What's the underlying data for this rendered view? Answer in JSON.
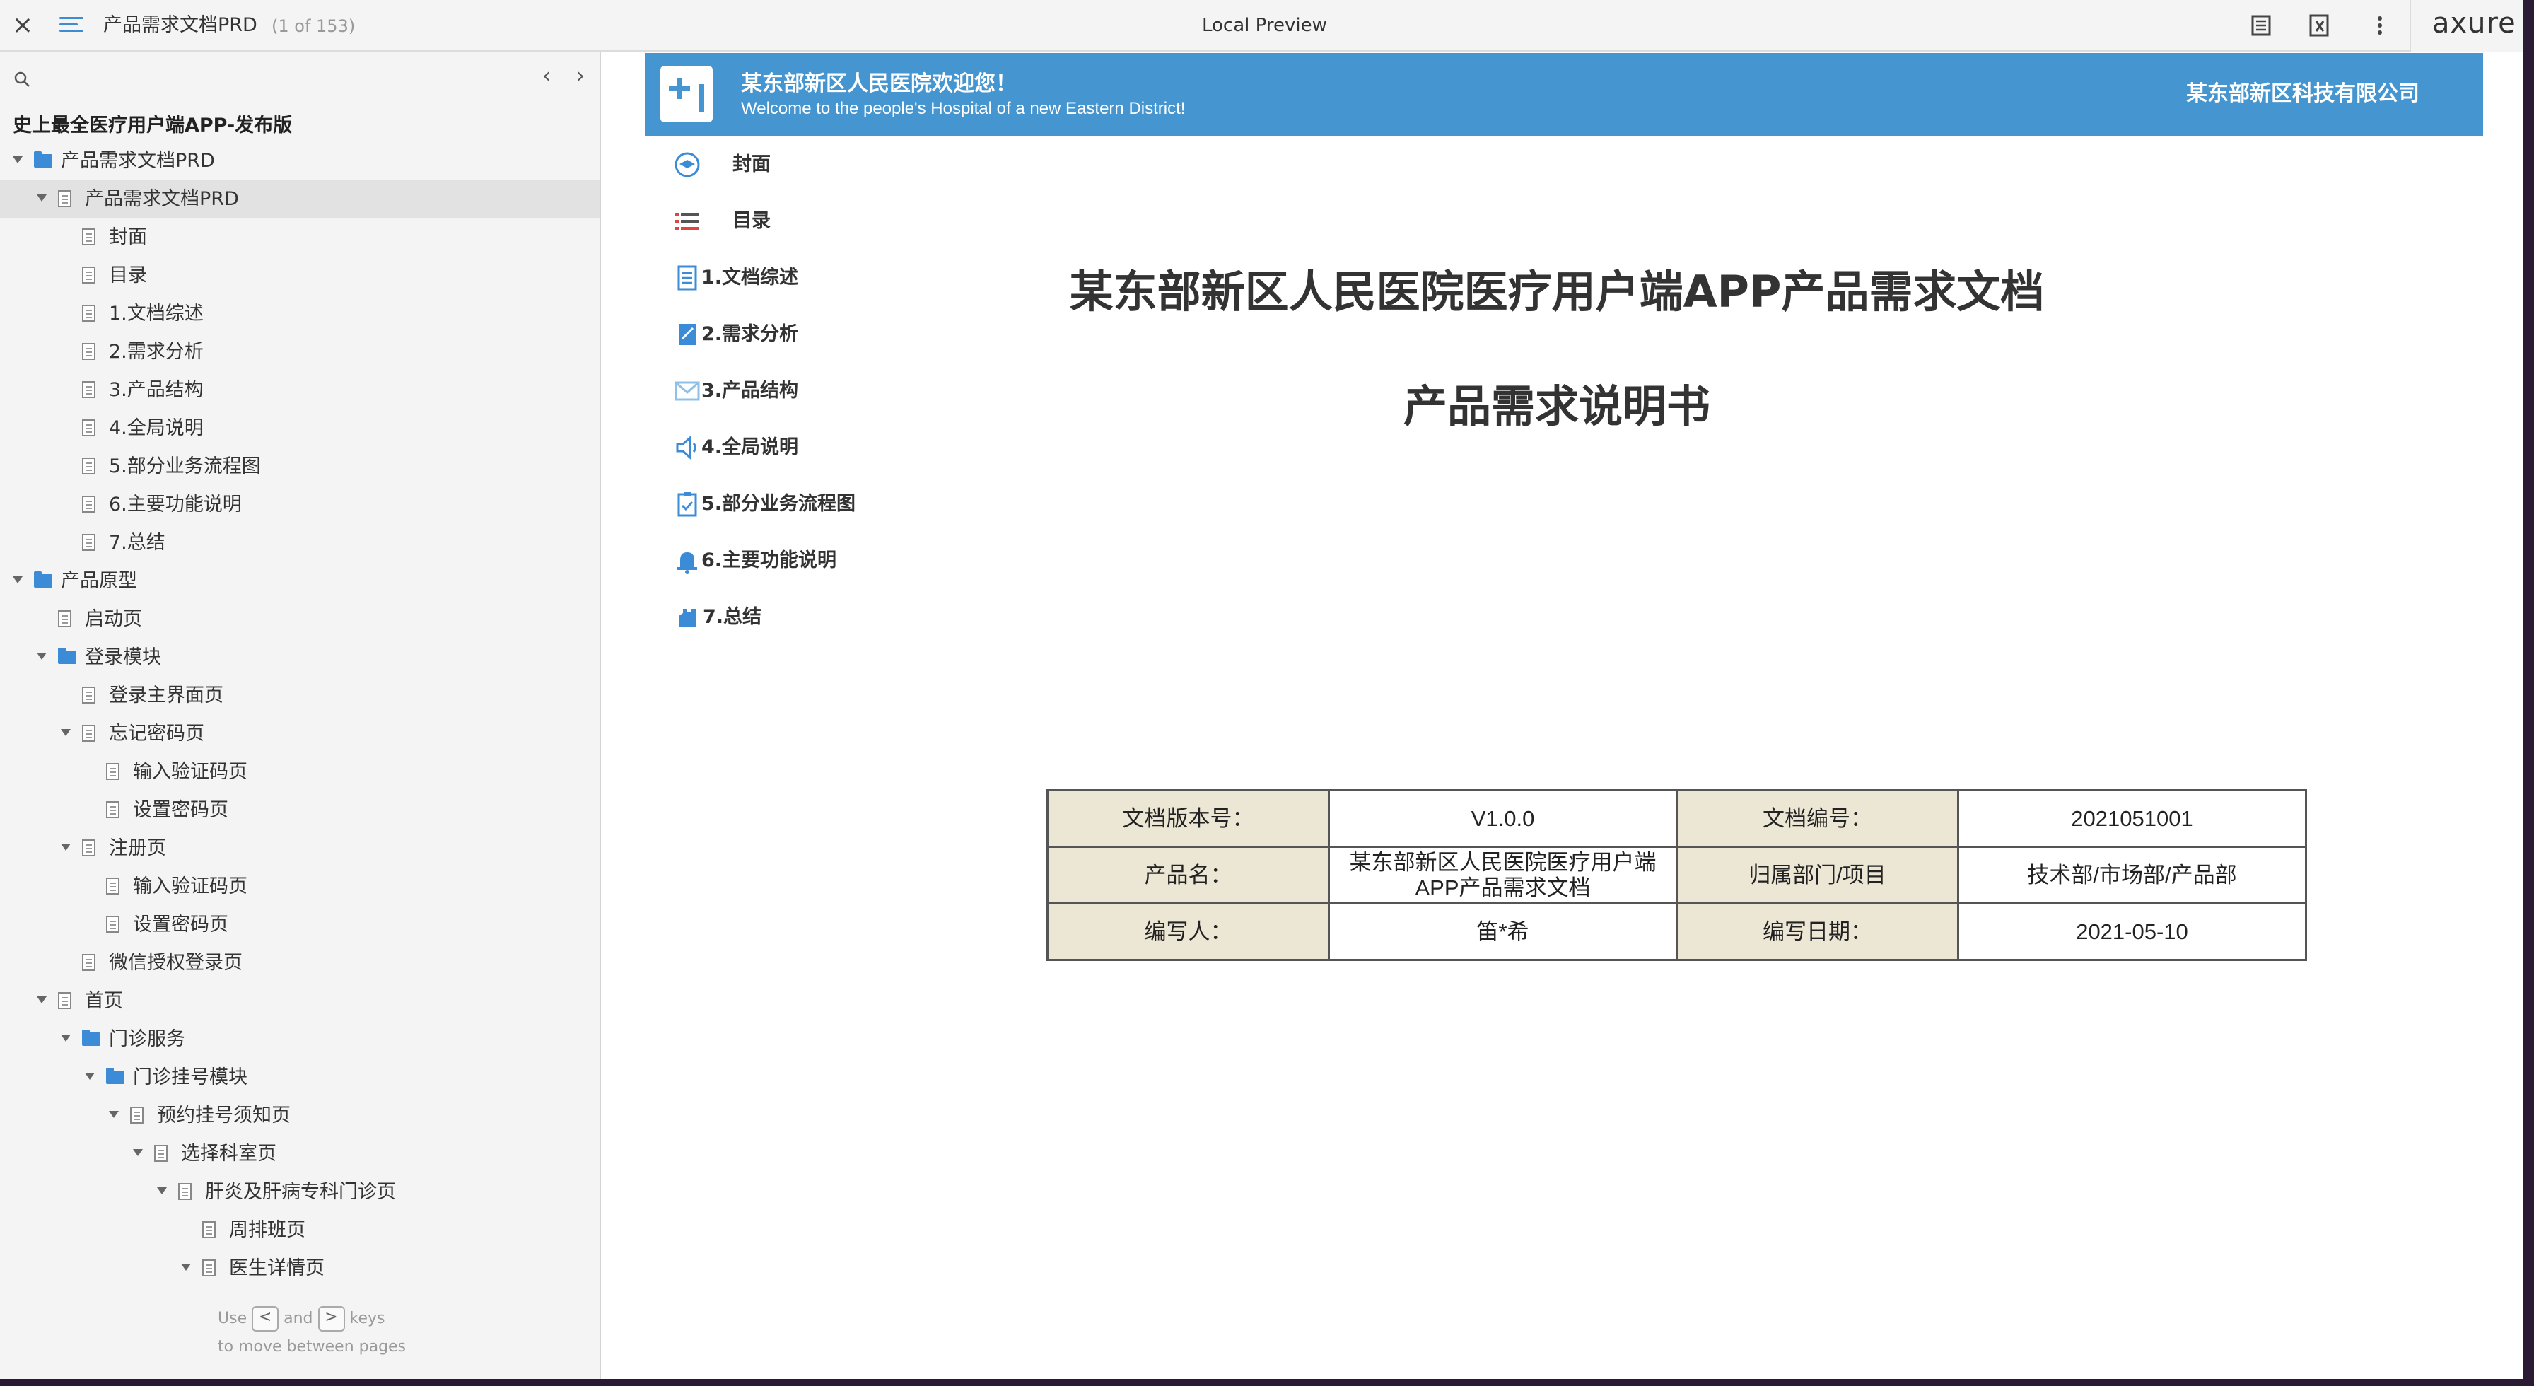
{
  "toolbar": {
    "close_glyph": "×",
    "doc_title": "产品需求文档PRD",
    "page_count": "(1 of 153)",
    "preview_label": "Local Preview",
    "logo": "axure",
    "icons": [
      "notes-icon",
      "adaptive-view-icon",
      "more-icon"
    ]
  },
  "sidebar": {
    "nav_prev": "‹",
    "nav_next": "›",
    "project_title": "史上最全医疗用户端APP-发布版",
    "hint": {
      "use": "Use",
      "key_prev": "<",
      "and": "and",
      "key_next": ">",
      "keys": "keys",
      "line2": "to move between pages"
    },
    "tree": [
      {
        "label": "产品需求文档PRD",
        "level": 0,
        "type": "folder",
        "expanded": true
      },
      {
        "label": "产品需求文档PRD",
        "level": 1,
        "type": "page",
        "expanded": true,
        "selected": true
      },
      {
        "label": "封面",
        "level": 2,
        "type": "page"
      },
      {
        "label": "目录",
        "level": 2,
        "type": "page"
      },
      {
        "label": "1.文档综述",
        "level": 2,
        "type": "page"
      },
      {
        "label": "2.需求分析",
        "level": 2,
        "type": "page"
      },
      {
        "label": "3.产品结构",
        "level": 2,
        "type": "page"
      },
      {
        "label": "4.全局说明",
        "level": 2,
        "type": "page"
      },
      {
        "label": "5.部分业务流程图",
        "level": 2,
        "type": "page"
      },
      {
        "label": "6.主要功能说明",
        "level": 2,
        "type": "page"
      },
      {
        "label": "7.总结",
        "level": 2,
        "type": "page"
      },
      {
        "label": "产品原型",
        "level": 0,
        "type": "folder",
        "expanded": true
      },
      {
        "label": "启动页",
        "level": 1,
        "type": "page"
      },
      {
        "label": "登录模块",
        "level": 1,
        "type": "folder",
        "expanded": true
      },
      {
        "label": "登录主界面页",
        "level": 2,
        "type": "page"
      },
      {
        "label": "忘记密码页",
        "level": 2,
        "type": "page",
        "expanded": true
      },
      {
        "label": "输入验证码页",
        "level": 3,
        "type": "page"
      },
      {
        "label": "设置密码页",
        "level": 3,
        "type": "page"
      },
      {
        "label": "注册页",
        "level": 2,
        "type": "page",
        "expanded": true
      },
      {
        "label": "输入验证码页",
        "level": 3,
        "type": "page"
      },
      {
        "label": "设置密码页",
        "level": 3,
        "type": "page"
      },
      {
        "label": "微信授权登录页",
        "level": 2,
        "type": "page"
      },
      {
        "label": "首页",
        "level": 1,
        "type": "page",
        "expanded": true
      },
      {
        "label": "门诊服务",
        "level": 2,
        "type": "folder",
        "expanded": true
      },
      {
        "label": "门诊挂号模块",
        "level": 3,
        "type": "folder",
        "expanded": true
      },
      {
        "label": "预约挂号须知页",
        "level": 4,
        "type": "page",
        "expanded": true
      },
      {
        "label": "选择科室页",
        "level": 5,
        "type": "page",
        "expanded": true
      },
      {
        "label": "肝炎及肝病专科门诊页",
        "level": 6,
        "type": "page",
        "expanded": true
      },
      {
        "label": "周排班页",
        "level": 7,
        "type": "page"
      },
      {
        "label": "医生详情页",
        "level": 7,
        "type": "page",
        "expanded": true
      }
    ]
  },
  "banner": {
    "welcome_cn": "某东部新区人民医院欢迎您！",
    "welcome_en": "Welcome to the people's Hospital of a new Eastern District!",
    "company": "某东部新区科技有限公司",
    "brand_color": "#4596d0"
  },
  "doc_nav": [
    {
      "label": "封面",
      "icon": "graduation-cap-icon"
    },
    {
      "label": "目录",
      "icon": "list-icon"
    },
    {
      "label": "1.文档综述",
      "icon": "document-icon"
    },
    {
      "label": "2.需求分析",
      "icon": "notebook-edit-icon"
    },
    {
      "label": "3.产品结构",
      "icon": "envelope-icon"
    },
    {
      "label": "4.全局说明",
      "icon": "speaker-icon"
    },
    {
      "label": "5.部分业务流程图",
      "icon": "clipboard-icon"
    },
    {
      "label": "6.主要功能说明",
      "icon": "bell-icon"
    },
    {
      "label": "7.总结",
      "icon": "hand-icon"
    }
  ],
  "document": {
    "title": "某东部新区人民医院医疗用户端APP产品需求文档",
    "subtitle": "产品需求说明书",
    "info": [
      [
        "文档版本号：",
        "V1.0.0",
        "文档编号：",
        "2021051001"
      ],
      [
        "产品名：",
        "某东部新区人民医院医疗用户端\nAPP产品需求文档",
        "归属部门/项目",
        "技术部/市场部/产品部"
      ],
      [
        "编写人：",
        "笛*希",
        "编写日期：",
        "2021-05-10"
      ]
    ]
  }
}
